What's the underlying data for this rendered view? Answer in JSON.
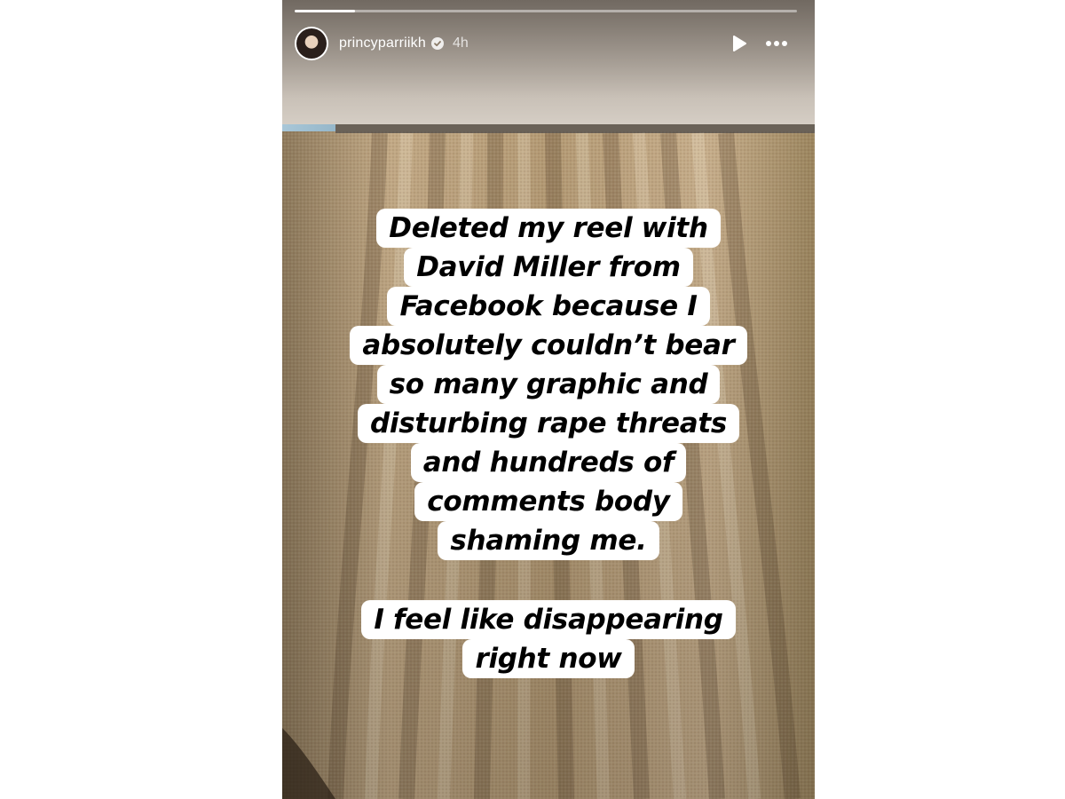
{
  "story": {
    "username": "princyparriikh",
    "verified": true,
    "time_ago": "4h",
    "progress": 0.12,
    "icons": {
      "play": "play-icon",
      "more": "more-options-icon",
      "verified": "verified-badge-icon",
      "avatar": "profile-avatar"
    },
    "colors": {
      "text_box_bg": "#ffffff",
      "text_color": "#000000",
      "curtain": "#b49a74"
    }
  },
  "overlay_text": {
    "paragraph1": [
      "Deleted my reel with",
      "David Miller from",
      "Facebook because I",
      "absolutely couldn’t bear",
      "so many graphic and",
      "disturbing rape threats",
      "and hundreds of",
      "comments body",
      "shaming me."
    ],
    "paragraph2": [
      "I feel like disappearing",
      "right now"
    ]
  }
}
